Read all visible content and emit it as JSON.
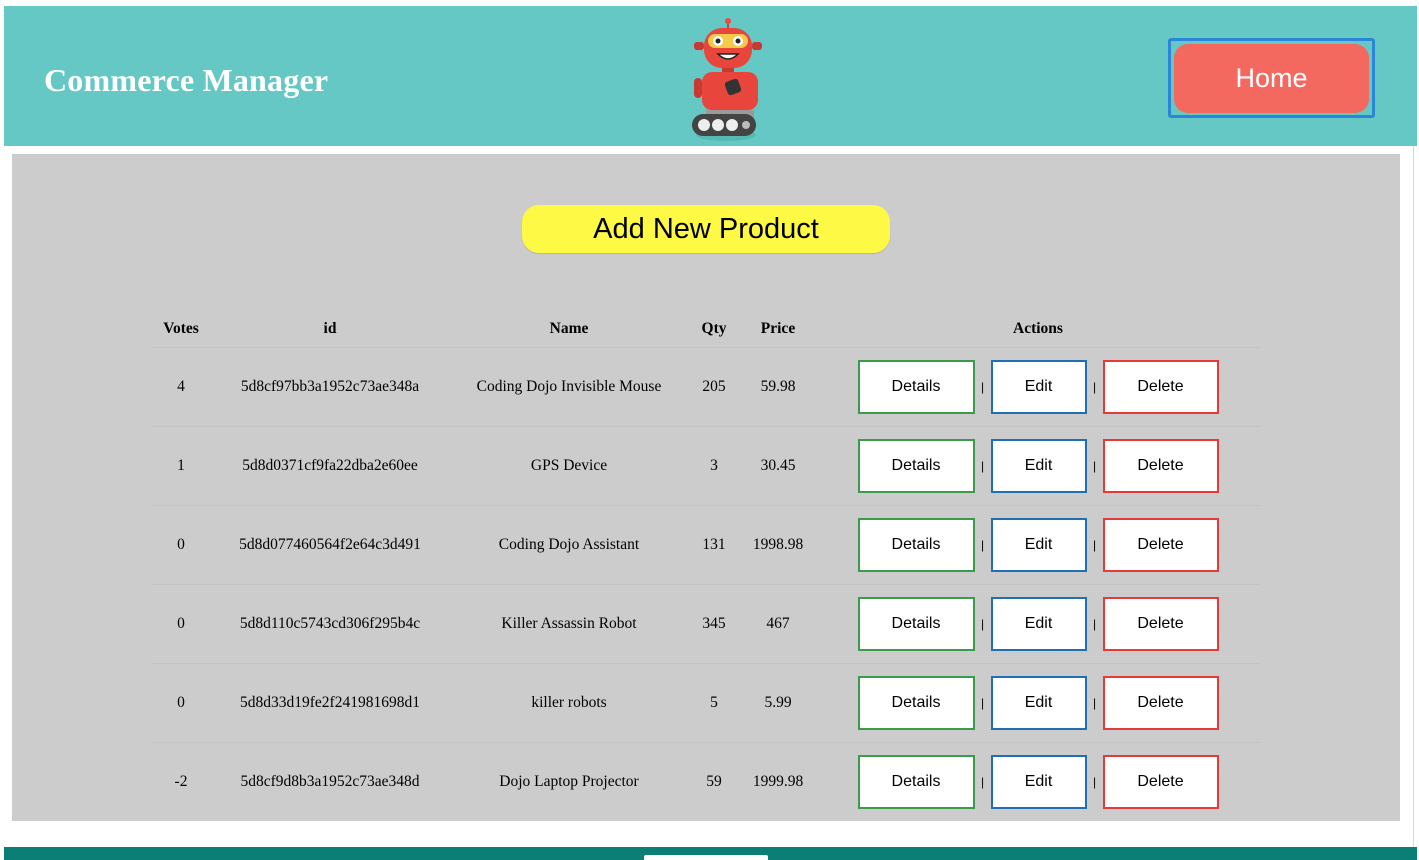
{
  "header": {
    "brand": "Commerce Manager",
    "logo_icon": "robot-icon",
    "home_label": "Home"
  },
  "main": {
    "add_label": "Add New Product"
  },
  "table": {
    "headers": {
      "votes": "Votes",
      "id": "id",
      "name": "Name",
      "qty": "Qty",
      "price": "Price",
      "actions": "Actions"
    },
    "rows": [
      {
        "votes": "4",
        "id": "5d8cf97bb3a1952c73ae348a",
        "name": "Coding Dojo Invisible Mouse",
        "qty": "205",
        "price": "59.98"
      },
      {
        "votes": "1",
        "id": "5d8d0371cf9fa22dba2e60ee",
        "name": "GPS Device",
        "qty": "3",
        "price": "30.45"
      },
      {
        "votes": "0",
        "id": "5d8d077460564f2e64c3d491",
        "name": "Coding Dojo Assistant",
        "qty": "131",
        "price": "1998.98"
      },
      {
        "votes": "0",
        "id": "5d8d110c5743cd306f295b4c",
        "name": "Killer Assassin Robot",
        "qty": "345",
        "price": "467"
      },
      {
        "votes": "0",
        "id": "5d8d33d19fe2f241981698d1",
        "name": "killer robots",
        "qty": "5",
        "price": "5.99"
      },
      {
        "votes": "-2",
        "id": "5d8cf9d8b3a1952c73ae348d",
        "name": "Dojo Laptop Projector",
        "qty": "59",
        "price": "1999.98"
      }
    ],
    "action_labels": {
      "details": "Details",
      "edit": "Edit",
      "delete": "Delete",
      "separator": "|"
    }
  },
  "colors": {
    "header_bg": "#66c8c4",
    "home_bg": "#f3685f",
    "add_bg": "#fdf945",
    "main_bg": "#cccccc",
    "details_border": "#3a9b4d",
    "edit_border": "#1f6fb6",
    "delete_border": "#e63a3a",
    "footer_bg": "#0b7f76"
  }
}
